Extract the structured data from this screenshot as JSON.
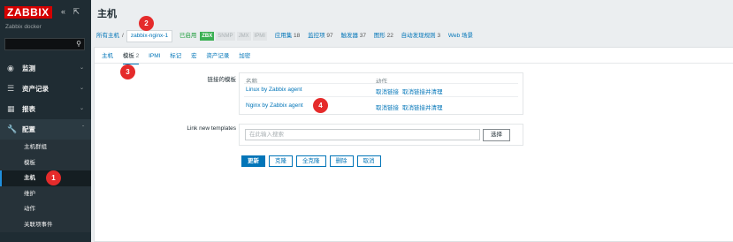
{
  "sidebar": {
    "logo": "ZABBIX",
    "controls": "« ⇱",
    "server_name": "Zabbix docker",
    "search_placeholder": "",
    "menu": [
      {
        "label": "监测",
        "icon": "eye-icon"
      },
      {
        "label": "资产记录",
        "icon": "list-icon"
      },
      {
        "label": "报表",
        "icon": "chart-icon"
      },
      {
        "label": "配置",
        "icon": "wrench-icon"
      }
    ],
    "config_submenu": [
      "主机群组",
      "模板",
      "主机",
      "维护",
      "动作",
      "关联项事件"
    ],
    "active_submenu": "主机"
  },
  "header": {
    "title": "主机"
  },
  "breadcrumb": {
    "all_hosts": "所有主机",
    "separator": "/",
    "host": "zabbix-nginx-1",
    "enabled": "已启用",
    "availability": [
      "ZBX",
      "SNMP",
      "JMX",
      "IPMI"
    ],
    "nav": [
      {
        "label": "应用集",
        "count": "18"
      },
      {
        "label": "监控项",
        "count": "97"
      },
      {
        "label": "触发器",
        "count": "37"
      },
      {
        "label": "图形",
        "count": "22"
      },
      {
        "label": "自动发现规则",
        "count": "3"
      },
      {
        "label": "Web 场景",
        "count": ""
      }
    ]
  },
  "tabs": [
    {
      "label": "主机",
      "count": ""
    },
    {
      "label": "模板",
      "count": "2"
    },
    {
      "label": "IPMI",
      "count": ""
    },
    {
      "label": "标记",
      "count": ""
    },
    {
      "label": "宏",
      "count": ""
    },
    {
      "label": "资产记录",
      "count": ""
    },
    {
      "label": "加密",
      "count": ""
    }
  ],
  "active_tab": "模板",
  "linked_templates": {
    "label": "链接的模板",
    "col_name": "名称",
    "col_action": "动作",
    "rows": [
      {
        "name": "Linux by Zabbix agent",
        "unlink": "取消链接",
        "unlink_clear": "取消链接并清理"
      },
      {
        "name": "Nginx by Zabbix agent",
        "unlink": "取消链接",
        "unlink_clear": "取消链接并清理"
      }
    ]
  },
  "new_templates": {
    "label": "Link new templates",
    "placeholder": "在此输入搜索",
    "select": "选择"
  },
  "buttons": {
    "update": "更新",
    "clone": "克隆",
    "full_clone": "全克隆",
    "delete": "删除",
    "cancel": "取消"
  },
  "callouts": [
    "1",
    "2",
    "3",
    "4"
  ],
  "colors": {
    "sidebar": "#1f2c33",
    "logo": "#d40000",
    "link": "#0275b8",
    "callout": "#e52b2b",
    "zbx": "#3bb053"
  }
}
